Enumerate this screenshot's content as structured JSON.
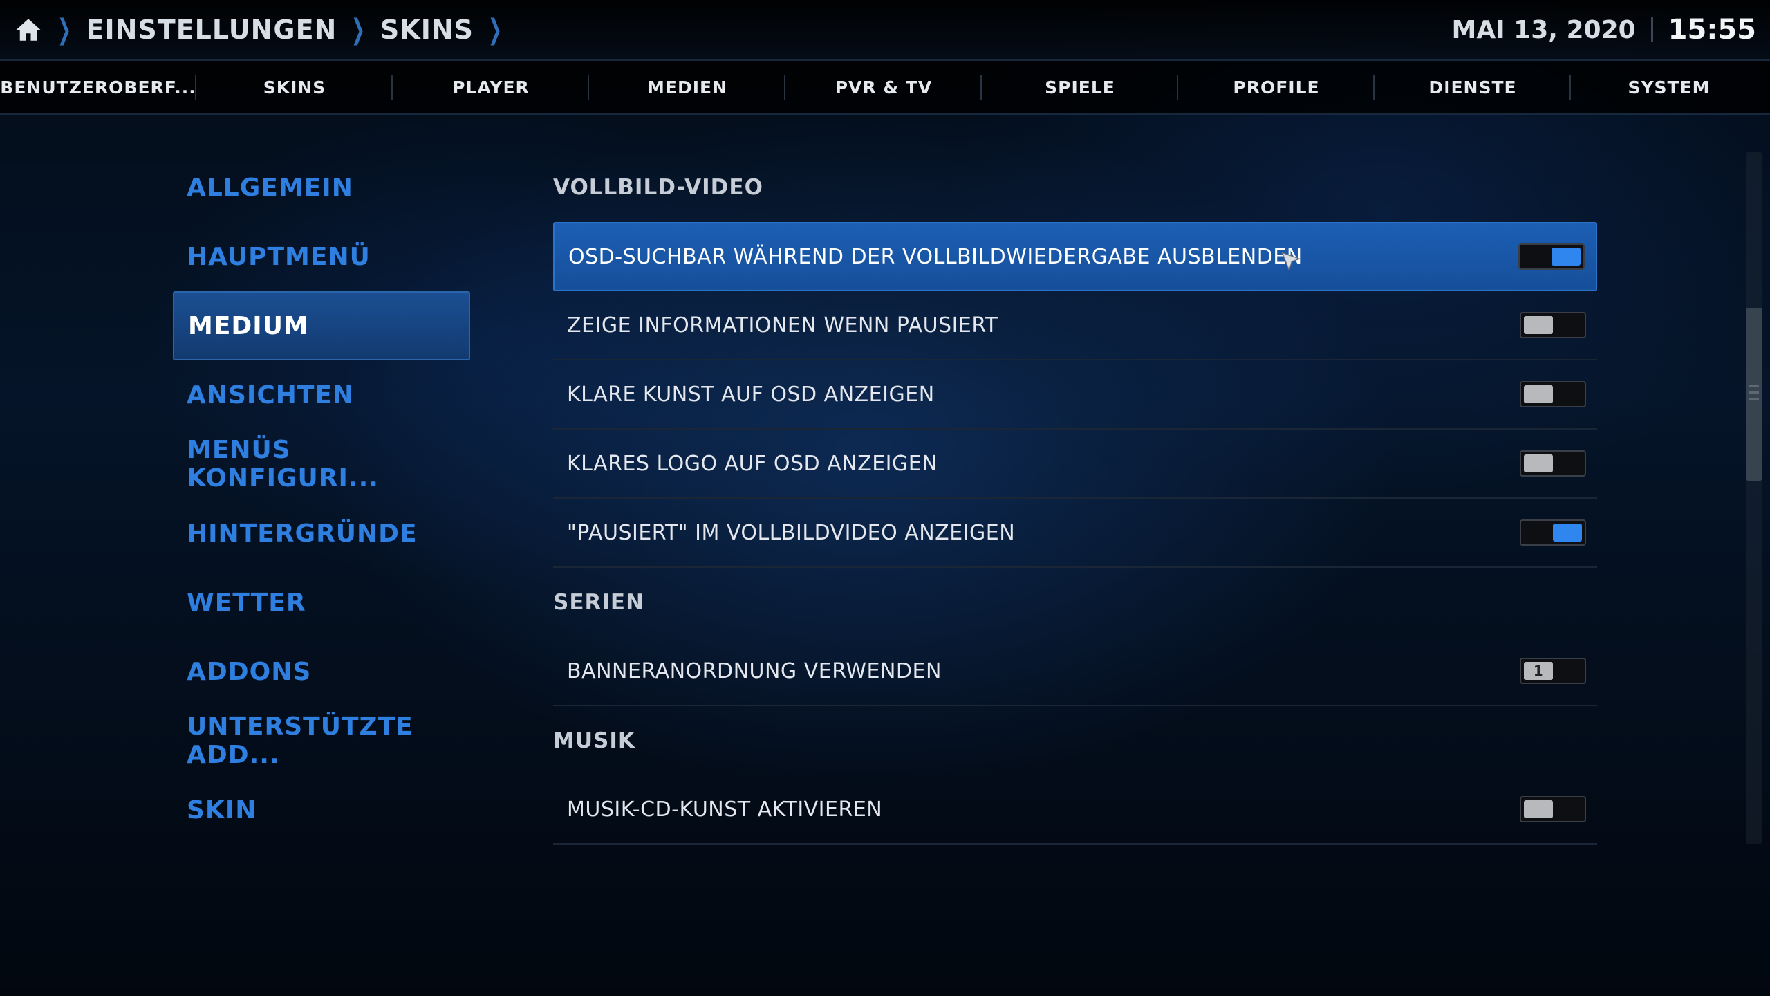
{
  "header": {
    "breadcrumb": [
      "EINSTELLUNGEN",
      "SKINS"
    ],
    "date": "MAI 13, 2020",
    "time": "15:55"
  },
  "tabs": [
    "BENUTZEROBERF...",
    "SKINS",
    "PLAYER",
    "MEDIEN",
    "PVR & TV",
    "SPIELE",
    "PROFILE",
    "DIENSTE",
    "SYSTEM"
  ],
  "menu": {
    "items": [
      "ALLGEMEIN",
      "HAUPTMENÜ",
      "MEDIUM",
      "ANSICHTEN",
      "MENÜS KONFIGURI...",
      "HINTERGRÜNDE",
      "WETTER",
      "ADDONS",
      "UNTERSTÜTZTE ADD...",
      "SKIN"
    ],
    "active_index": 2
  },
  "settings": {
    "section_video": "VOLLBILD-VIDEO",
    "section_series": "SERIEN",
    "section_music": "MUSIK",
    "rows": [
      {
        "label": "OSD-SUCHBAR WÄHREND DER VOLLBILDWIEDERGABE AUSBLENDEN",
        "state": "on"
      },
      {
        "label": "ZEIGE INFORMATIONEN WENN PAUSIERT",
        "state": "off"
      },
      {
        "label": "KLARE KUNST AUF OSD ANZEIGEN",
        "state": "off"
      },
      {
        "label": "KLARES LOGO AUF OSD ANZEIGEN",
        "state": "off"
      },
      {
        "label": "\"PAUSIERT\" IM VOLLBILDVIDEO ANZEIGEN",
        "state": "on"
      },
      {
        "label": "BANNERANORDNUNG VERWENDEN",
        "state": "off",
        "knob_text": "1"
      },
      {
        "label": "MUSIK-CD-KUNST AKTIVIEREN",
        "state": "off"
      }
    ]
  },
  "colors": {
    "accent": "#2f86ef",
    "menu_text": "#2f7fe0",
    "focus": "#1c5fb4"
  }
}
